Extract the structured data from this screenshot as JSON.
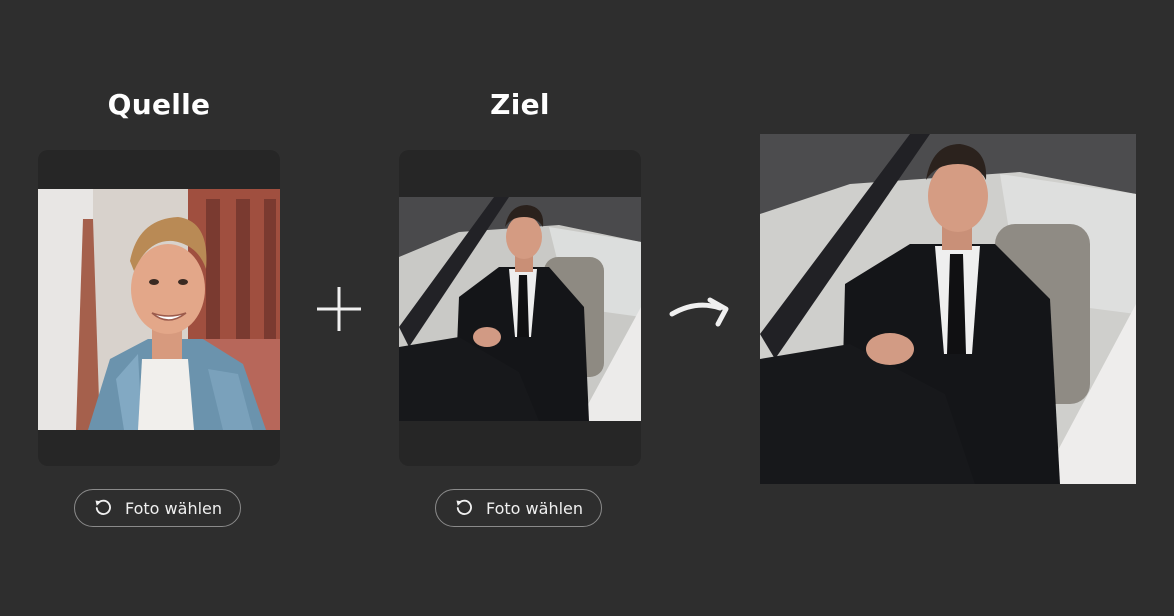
{
  "source": {
    "title": "Quelle",
    "button_label": "Foto wählen",
    "button_icon": "rotate-ccw-icon"
  },
  "target": {
    "title": "Ziel",
    "button_label": "Foto wählen",
    "button_icon": "rotate-ccw-icon"
  },
  "operators": {
    "plus_icon": "plus-icon",
    "arrow_icon": "curved-arrow-right-icon"
  },
  "colors": {
    "background": "#2e2e2e",
    "frame": "#262626",
    "button_border": "#8a8a8a",
    "text": "#ffffff"
  }
}
